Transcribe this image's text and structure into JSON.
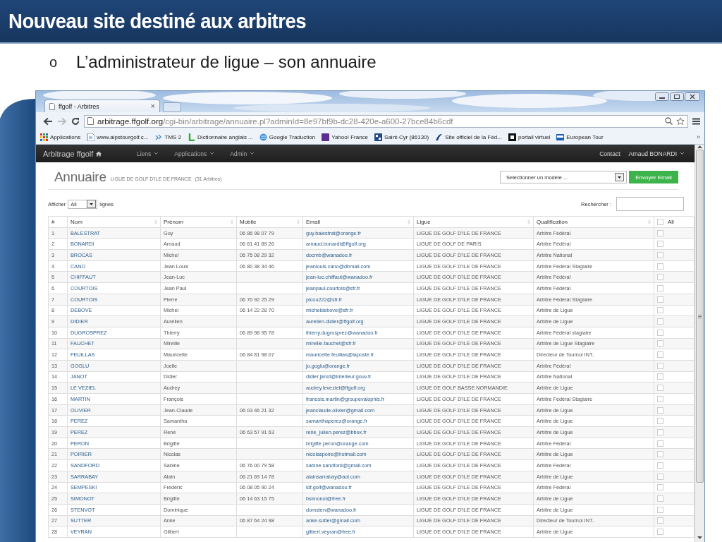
{
  "slide": {
    "title": "Nouveau site destiné aux arbitres",
    "bullet": {
      "marker": "o",
      "text": "L’administrateur de ligue – son annuaire"
    }
  },
  "browser": {
    "tab": {
      "title": "ffgolf - Arbitres",
      "close": "×"
    },
    "url": {
      "host": "arbitrage.ffgolf.org",
      "path": "/cgi-bin/arbitrage/annuaire.pl?adminId=8e97bf9b-dc28-420e-a600-27bce84b6cdf"
    },
    "bookmarks": [
      {
        "label": "Applications"
      },
      {
        "label": "www.alpstourgolf.c..."
      },
      {
        "label": "TMS 2"
      },
      {
        "label": "Dictionnaire anglais ..."
      },
      {
        "label": "Google Traduction"
      },
      {
        "label": "Yahoo! France"
      },
      {
        "label": "Saint-Cyr (86130)"
      },
      {
        "label": "Site officiel de la Féd..."
      },
      {
        "label": "portail virtuel"
      },
      {
        "label": "European Tour"
      }
    ],
    "bookmarks_more": "»"
  },
  "app": {
    "brand": "Arbitrage ffgolf",
    "menu": [
      {
        "label": "Liens"
      },
      {
        "label": "Applications"
      },
      {
        "label": "Admin"
      }
    ],
    "contact": "Contact",
    "user": "Arnaud BONARDI"
  },
  "page": {
    "title": "Annuaire",
    "subtitle": "LIGUE DE GOLF D'ILE DE FRANCE",
    "count": "(31 Arbitres)",
    "template_select": "Selectionner un modèle ...",
    "send_button": "Envoyer Email",
    "length_label": "Afficher",
    "length_select": "All",
    "length_suffix": "lignes",
    "search_label": "Rechercher :"
  },
  "table": {
    "columns": [
      {
        "label": "#",
        "sortable": false
      },
      {
        "label": "Nom",
        "sortable": true
      },
      {
        "label": "Prénom",
        "sortable": true
      },
      {
        "label": "Mobile",
        "sortable": true
      },
      {
        "label": "Email",
        "sortable": true
      },
      {
        "label": "Ligue",
        "sortable": true
      },
      {
        "label": "Qualification",
        "sortable": true
      },
      {
        "label": "All",
        "sortable": false
      }
    ],
    "select_all": {
      "checked": false
    },
    "rows": [
      {
        "num": "1",
        "nom": "BALESTRAT",
        "prenom": "Guy",
        "mobile": "06 86 98 07 79",
        "email": "guy.balestrat@orange.fr",
        "ligue": "LIGUE DE GOLF D'ILE DE FRANCE",
        "qualification": "Arbitre Fédéral",
        "checked": false
      },
      {
        "num": "2",
        "nom": "BONARDI",
        "prenom": "Arnaud",
        "mobile": "06 61 41 89 26",
        "email": "arnaud.bonardi@ffgolf.org",
        "ligue": "LIGUE DE GOLF DE PARIS",
        "qualification": "Arbitre Fédéral",
        "checked": false
      },
      {
        "num": "3",
        "nom": "BROCAS",
        "prenom": "Michel",
        "mobile": "06 75 08 29 32",
        "email": "docmb@wanadoo.fr",
        "ligue": "LIGUE DE GOLF D'ILE DE FRANCE",
        "qualification": "Arbitre National",
        "checked": false
      },
      {
        "num": "4",
        "nom": "CANO",
        "prenom": "Jean Louis",
        "mobile": "06 80 38 34 46",
        "email": "jeanlouis.cano@dbmail.com",
        "ligue": "LIGUE DE GOLF D'ILE DE FRANCE",
        "qualification": "Arbitre Fédéral Stagiaire",
        "checked": false
      },
      {
        "num": "5",
        "nom": "CHIFFAUT",
        "prenom": "Jean-Luc",
        "email": "jean-luc.chiffaut@wanadoo.fr",
        "ligue": "LIGUE DE GOLF D'ILE DE FRANCE",
        "qualification": "Arbitre Fédéral",
        "checked": false
      },
      {
        "num": "6",
        "nom": "COURTOIS",
        "prenom": "Jean Paul",
        "email": "jeanpaul.courtois@sfr.fr",
        "ligue": "LIGUE DE GOLF D'ILE DE FRANCE",
        "qualification": "Arbitre Fédéral",
        "checked": false
      },
      {
        "num": "7",
        "nom": "COURTOIS",
        "prenom": "Pierre",
        "mobile": "06 70 92 25 29",
        "email": "picou222@sfr.fr",
        "ligue": "LIGUE DE GOLF D'ILE DE FRANCE",
        "qualification": "Arbitre Fédéral Stagiaire",
        "checked": false
      },
      {
        "num": "8",
        "nom": "DEBOVE",
        "prenom": "Michel",
        "mobile": "06 14 22 28 70",
        "email": "micheldebove@sfr.fr",
        "ligue": "LIGUE DE GOLF D'ILE DE FRANCE",
        "qualification": "Arbitre de Ligue",
        "checked": false
      },
      {
        "num": "9",
        "nom": "DIDIER",
        "prenom": "Aurélien",
        "email": "aurelien.didier@ffgolf.org",
        "ligue": "LIGUE DE GOLF D'ILE DE FRANCE",
        "qualification": "Arbitre de Ligue",
        "checked": false
      },
      {
        "num": "10",
        "nom": "DUGROSPREZ",
        "prenom": "Thierry",
        "mobile": "06 89 98 95 78",
        "email": "thierry.dugrosprez@wanadoo.fr",
        "ligue": "LIGUE DE GOLF D'ILE DE FRANCE",
        "qualification": "Arbitre Fédéral stagiaire",
        "checked": false
      },
      {
        "num": "11",
        "nom": "FAUCHET",
        "prenom": "Mireille",
        "email": "mireille.fauchet@sfr.fr",
        "ligue": "LIGUE DE GOLF D'ILE DE FRANCE",
        "qualification": "Arbitre de Ligue Stagiaire",
        "checked": false
      },
      {
        "num": "12",
        "nom": "FEUILLAS",
        "prenom": "Mauricette",
        "mobile": "06 84 81 98 07",
        "email": "mauricette.feuillas@laposte.fr",
        "ligue": "LIGUE DE GOLF D'ILE DE FRANCE",
        "qualification": "Directeur de Tournoi INT..",
        "checked": false
      },
      {
        "num": "13",
        "nom": "GOGLU",
        "prenom": "Joelle",
        "email": "jo.goglu@orange.fr",
        "ligue": "LIGUE DE GOLF D'ILE DE FRANCE",
        "qualification": "Arbitre Fédéral",
        "checked": false
      },
      {
        "num": "14",
        "nom": "JANOT",
        "prenom": "Didier",
        "email": "didier.janot@interieur.gouv.fr",
        "ligue": "LIGUE DE GOLF D'ILE DE FRANCE",
        "qualification": "Arbitre National",
        "checked": false
      },
      {
        "num": "15",
        "nom": "LE VEZIEL",
        "prenom": "Audrey",
        "email": "audrey.leveziel@ffgolf.org",
        "ligue": "LIGUE DE GOLF BASSE NORMANDIE",
        "qualification": "Arbitre de Ligue",
        "checked": false
      },
      {
        "num": "16",
        "nom": "MARTIN",
        "prenom": "François",
        "email": "francois.martin@groupevalophis.fr",
        "ligue": "LIGUE DE GOLF D'ILE DE FRANCE",
        "qualification": "Arbitre Fédéral Stagiaire",
        "checked": false
      },
      {
        "num": "17",
        "nom": "OLIVIER",
        "prenom": "Jean-Claude",
        "mobile": "06 03 46 21 32",
        "email": "jeanclaude.olivier@gmail.com",
        "ligue": "LIGUE DE GOLF D'ILE DE FRANCE",
        "qualification": "Arbitre de Ligue",
        "checked": false
      },
      {
        "num": "18",
        "nom": "PEREZ",
        "prenom": "Samantha",
        "email": "samanthaperez@orange.fr",
        "ligue": "LIGUE DE GOLF D'ILE DE FRANCE",
        "qualification": "Arbitre de Ligue",
        "checked": false
      },
      {
        "num": "19",
        "nom": "PEREZ",
        "prenom": "René",
        "mobile": "06 63 57 91 63",
        "email": "rene_julien.perez@bbox.fr",
        "ligue": "LIGUE DE GOLF D'ILE DE FRANCE",
        "qualification": "Arbitre de Ligue",
        "checked": false
      },
      {
        "num": "20",
        "nom": "PERON",
        "prenom": "Brigitte",
        "email": "brigitte.peron@orange.com",
        "ligue": "LIGUE DE GOLF D'ILE DE FRANCE",
        "qualification": "Arbitre Fédéral",
        "checked": false
      },
      {
        "num": "21",
        "nom": "POIRIER",
        "prenom": "Nicolas",
        "email": "nicolaspoire@hotmail.com",
        "ligue": "LIGUE DE GOLF D'ILE DE FRANCE",
        "qualification": "Arbitre de Ligue",
        "checked": false
      },
      {
        "num": "22",
        "nom": "SANDFORD",
        "prenom": "Sabine",
        "mobile": "06 76 00 79 58",
        "email": "sabine.sandford@gmail.com",
        "ligue": "LIGUE DE GOLF D'ILE DE FRANCE",
        "qualification": "Arbitre Fédéral",
        "checked": false
      },
      {
        "num": "23",
        "nom": "SARRABAY",
        "prenom": "Alain",
        "mobile": "06 21 69 14 78",
        "email": "alainsarrabay@aol.com",
        "ligue": "LIGUE DE GOLF D'ILE DE FRANCE",
        "qualification": "Arbitre de Ligue",
        "checked": false
      },
      {
        "num": "24",
        "nom": "SEMPESKI",
        "prenom": "Frédéric",
        "mobile": "06 08 05 90 24",
        "email": "idf.golf@wanadoo.fr",
        "ligue": "LIGUE DE GOLF D'ILE DE FRANCE",
        "qualification": "Arbitre Fédéral",
        "checked": false
      },
      {
        "num": "25",
        "nom": "SIMONOT",
        "prenom": "Brigitte",
        "mobile": "06 14 63 15 75",
        "email": "bsimonot@free.fr",
        "ligue": "LIGUE DE GOLF D'ILE DE FRANCE",
        "qualification": "Arbitre de Ligue",
        "checked": false
      },
      {
        "num": "26",
        "nom": "STENVOT",
        "prenom": "Dominique",
        "email": "domsten@wanadoo.fr",
        "ligue": "LIGUE DE GOLF D'ILE DE FRANCE",
        "qualification": "Arbitre de Ligue",
        "checked": false
      },
      {
        "num": "27",
        "nom": "SUTTER",
        "prenom": "Anke",
        "mobile": "06 87 64 24 98",
        "email": "anke.sutter@gmail.com",
        "ligue": "LIGUE DE GOLF D'ILE DE FRANCE",
        "qualification": "Directeur de Tournoi INT..",
        "checked": false
      },
      {
        "num": "28",
        "nom": "VEYRAN",
        "prenom": "Gilbert",
        "email": "gilbert.veyran@free.fr",
        "ligue": "LIGUE DE GOLF D'ILE DE FRANCE",
        "qualification": "Arbitre de Ligue",
        "checked": false
      }
    ]
  }
}
